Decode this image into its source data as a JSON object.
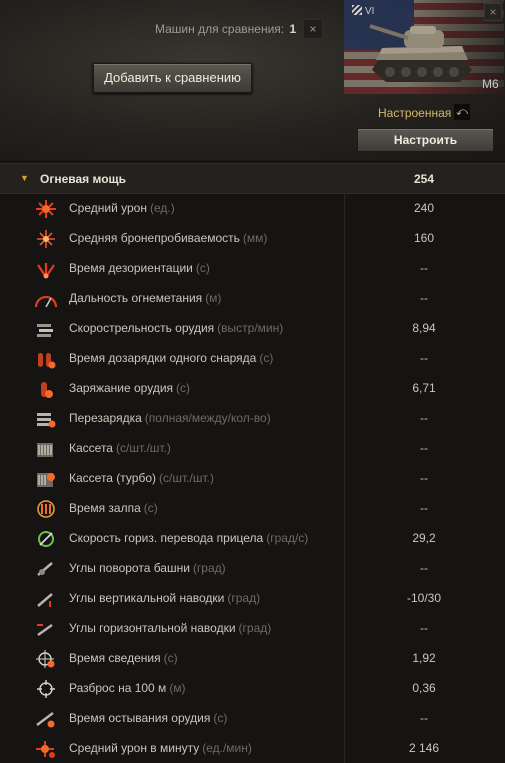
{
  "compare": {
    "label": "Машин для сравнения:",
    "count": "1",
    "close_glyph": "×",
    "add_button": "Добавить к сравнению"
  },
  "vehicle": {
    "tier": "VI",
    "name": "M6",
    "status": "Настроенная",
    "reset_glyph": "⤺",
    "close_glyph": "×",
    "configure_button": "Настроить",
    "nation_flag": "usa-flag"
  },
  "section": {
    "arrow": "▼",
    "title": "Огневая мощь",
    "total": "254"
  },
  "colors": {
    "accent": "#e0a030",
    "status": "#d6b86a",
    "icon_red": "#e23b1e"
  },
  "stats": [
    {
      "icon": "damage-icon",
      "label": "Средний урон",
      "unit": "(ед.)",
      "value": "240"
    },
    {
      "icon": "penetration-icon",
      "label": "Средняя бронепробиваемость",
      "unit": "(мм)",
      "value": "160"
    },
    {
      "icon": "stun-icon",
      "label": "Время дезориентации",
      "unit": "(с)",
      "value": "--"
    },
    {
      "icon": "flame-range-icon",
      "label": "Дальность огнеметания",
      "unit": "(м)",
      "value": "--"
    },
    {
      "icon": "rate-of-fire-icon",
      "label": "Скорострельность орудия",
      "unit": "(выстр/мин)",
      "value": "8,94"
    },
    {
      "icon": "shell-reload-icon",
      "label": "Время дозарядки одного снаряда",
      "unit": "(с)",
      "value": "--"
    },
    {
      "icon": "reload-icon",
      "label": "Заряжание орудия",
      "unit": "(с)",
      "value": "6,71"
    },
    {
      "icon": "clip-reload-icon",
      "label": "Перезарядка",
      "unit": "(полная/между/кол-во)",
      "value": "--"
    },
    {
      "icon": "magazine-icon",
      "label": "Кассета",
      "unit": "(с/шт./шт.)",
      "value": "--"
    },
    {
      "icon": "magazine-turbo-icon",
      "label": "Кассета (турбо)",
      "unit": "(с/шт./шт.)",
      "value": "--"
    },
    {
      "icon": "salvo-icon",
      "label": "Время залпа",
      "unit": "(с)",
      "value": "--"
    },
    {
      "icon": "traverse-speed-icon",
      "label": "Скорость гориз. перевода прицела",
      "unit": "(град/с)",
      "value": "29,2"
    },
    {
      "icon": "turret-angles-icon",
      "label": "Углы поворота башни",
      "unit": "(град)",
      "value": "--"
    },
    {
      "icon": "elevation-icon",
      "label": "Углы вертикальной наводки",
      "unit": "(град)",
      "value": "-10/30"
    },
    {
      "icon": "horizontal-aim-icon",
      "label": "Углы горизонтальной наводки",
      "unit": "(град)",
      "value": "--"
    },
    {
      "icon": "aim-time-icon",
      "label": "Время сведения",
      "unit": "(с)",
      "value": "1,92"
    },
    {
      "icon": "dispersion-icon",
      "label": "Разброс на 100 м",
      "unit": "(м)",
      "value": "0,36"
    },
    {
      "icon": "cooldown-icon",
      "label": "Время остывания орудия",
      "unit": "(с)",
      "value": "--"
    },
    {
      "icon": "dpm-icon",
      "label": "Средний урон в минуту",
      "unit": "(ед./мин)",
      "value": "2 146"
    }
  ]
}
